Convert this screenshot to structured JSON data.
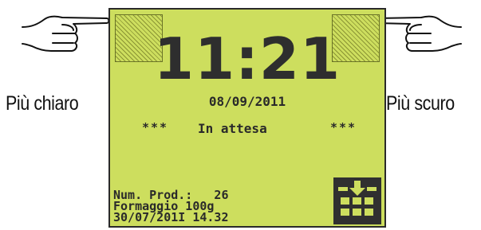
{
  "labels": {
    "left": "Più chiaro",
    "right": "Più scuro"
  },
  "display": {
    "time": "11:21",
    "date": "08/09/2011",
    "status_decoration": "***",
    "status": "In attesa",
    "info_lines": [
      "Num. Prod.:   26",
      "Formaggio 100g",
      "30/07/201I 14.32"
    ]
  },
  "icons": {
    "hand_left": "pointing-hand-right-icon",
    "hand_right": "pointing-hand-left-icon",
    "calendar": "calendar-download-icon"
  },
  "colors": {
    "screen_background": "#cdde5e",
    "screen_text": "#2e2e2e",
    "icon_button": "#303030"
  }
}
